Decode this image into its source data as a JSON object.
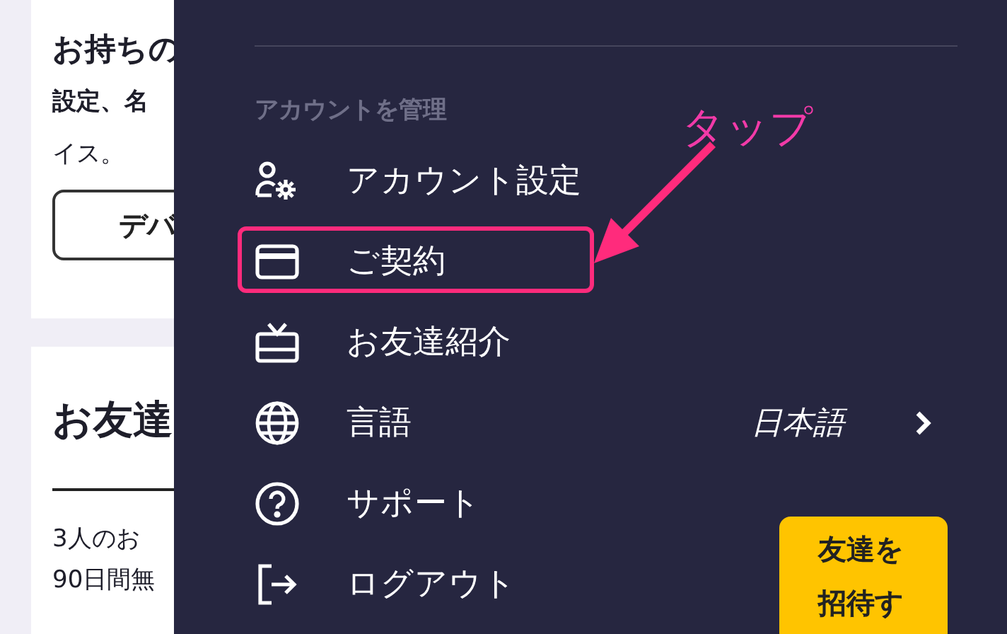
{
  "page": {
    "devices_card": {
      "title": "お持ちの",
      "lines": [
        {
          "text": "設定、名",
          "bold": true
        },
        {
          "text": "イス。",
          "bold": false
        }
      ],
      "button": "デバ"
    },
    "friends_card": {
      "title": "お友達",
      "lines": [
        "3人のお",
        "90日間無"
      ]
    }
  },
  "drawer": {
    "section": "アカウントを管理",
    "items": [
      {
        "kind": "account_settings",
        "label": "アカウント設定",
        "highlighted": false
      },
      {
        "kind": "billing",
        "label": "ご契約",
        "highlighted": true
      },
      {
        "kind": "referral",
        "label": "お友達紹介",
        "highlighted": false
      },
      {
        "kind": "language",
        "label": "言語",
        "value": "日本語",
        "highlighted": false
      },
      {
        "kind": "support",
        "label": "サポート",
        "highlighted": false
      },
      {
        "kind": "logout",
        "label": "ログアウト",
        "highlighted": false
      }
    ],
    "invite_button": "友達を招待す"
  },
  "annotation": {
    "text": "タップ"
  }
}
